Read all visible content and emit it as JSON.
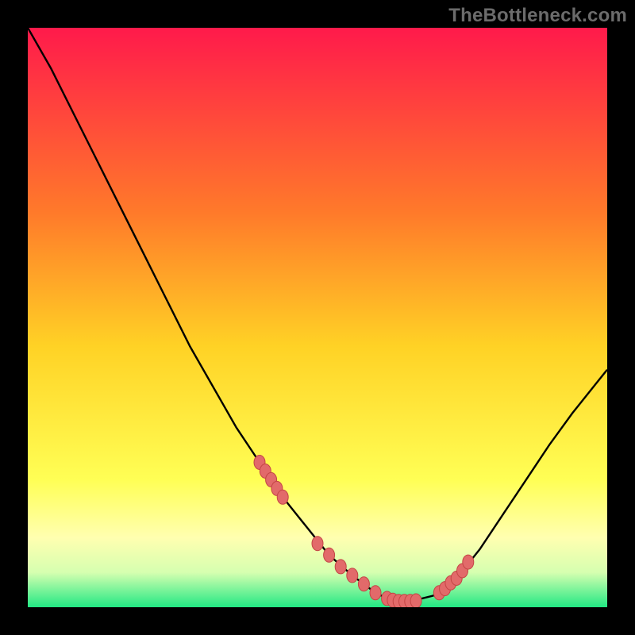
{
  "watermark": {
    "text": "TheBottleneck.com"
  },
  "colors": {
    "bg": "#000000",
    "grad_top": "#ff1a4b",
    "grad_mid1": "#ff7a2a",
    "grad_mid2": "#ffd225",
    "grad_mid3": "#ffff55",
    "grad_low1": "#ffffb0",
    "grad_low2": "#d6ffb0",
    "grad_bottom": "#22e884",
    "curve": "#000000",
    "marker_fill": "#e26a6a",
    "marker_stroke": "#c44545"
  },
  "chart_data": {
    "type": "line",
    "title": "",
    "xlabel": "",
    "ylabel": "",
    "xlim": [
      0,
      100
    ],
    "ylim": [
      0,
      100
    ],
    "curve": {
      "x": [
        0,
        4,
        8,
        12,
        16,
        20,
        24,
        28,
        32,
        36,
        40,
        44,
        48,
        52,
        56,
        60,
        62,
        64,
        66,
        70,
        74,
        78,
        82,
        86,
        90,
        94,
        98,
        100
      ],
      "y": [
        100,
        93,
        85,
        77,
        69,
        61,
        53,
        45,
        38,
        31,
        25,
        19,
        14,
        9,
        5.5,
        2.5,
        1.5,
        1,
        1,
        2,
        5,
        10,
        16,
        22,
        28,
        33.5,
        38.5,
        41
      ]
    },
    "highlight_points": {
      "x": [
        40,
        41,
        42,
        43,
        44,
        50,
        52,
        54,
        56,
        58,
        60,
        62,
        63,
        64,
        65,
        66,
        67,
        71,
        72,
        73,
        74,
        75,
        76
      ],
      "y": [
        25,
        23.5,
        22,
        20.5,
        19,
        11,
        9,
        7,
        5.5,
        4,
        2.5,
        1.5,
        1.2,
        1,
        1,
        1,
        1.1,
        2.5,
        3.2,
        4.2,
        5,
        6.3,
        7.8
      ]
    }
  }
}
